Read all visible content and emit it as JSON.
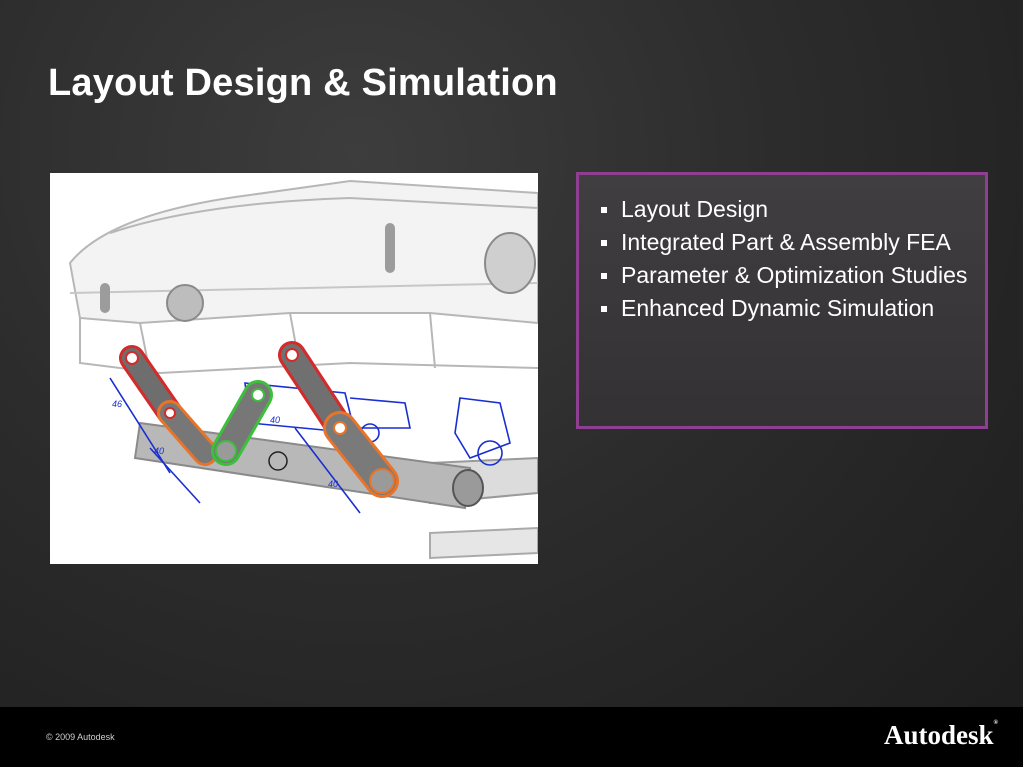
{
  "slide": {
    "title": "Layout Design & Simulation"
  },
  "figure": {
    "dimension_labels": [
      "46",
      "40",
      "40",
      "40"
    ]
  },
  "bullets": [
    {
      "text": "Layout Design"
    },
    {
      "text": "Integrated Part & Assembly FEA"
    },
    {
      "text": "Parameter & Optimization Studies"
    },
    {
      "text": "Enhanced Dynamic Simulation"
    }
  ],
  "footer": {
    "copyright": "© 2009 Autodesk",
    "logo_text": "Autodesk"
  },
  "colors": {
    "accent_border": "#8e3f92",
    "footer_bg": "#000000",
    "link_red": "#d42a2a",
    "link_green": "#3cbf3c",
    "link_orange": "#e8742a",
    "sketch_blue": "#1a2fd0"
  }
}
